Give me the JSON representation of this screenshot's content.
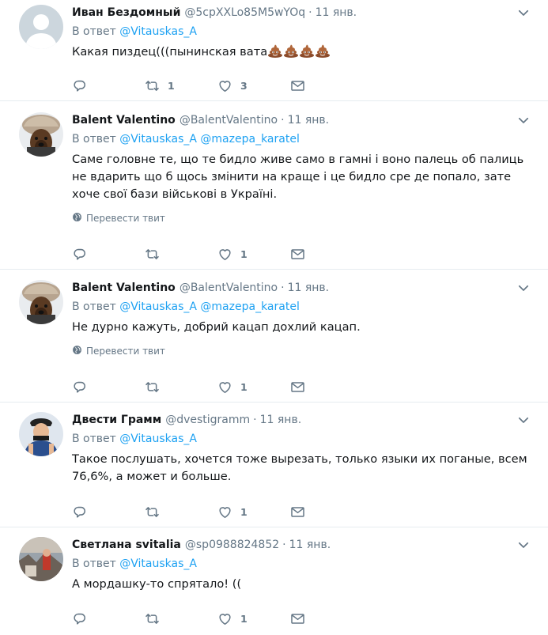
{
  "labels": {
    "reply_prefix": "В ответ",
    "translate": "Перевести твит",
    "time_sep": "·"
  },
  "icons": {
    "reply": "reply-icon",
    "retweet": "retweet-icon",
    "like": "heart-icon",
    "dm": "envelope-icon",
    "caret": "chevron-down-icon",
    "globe": "globe-icon",
    "emoji": "poop-emoji"
  },
  "colors": {
    "accent": "#1da1f2",
    "muted": "#657786",
    "text": "#14171a",
    "divider": "#e6ecf0"
  },
  "tweets": [
    {
      "name": "Иван Бездомный",
      "handle": "@5cpXXLo85M5wYOq",
      "time": "11 янв.",
      "mentions": [
        "@Vitauskas_A"
      ],
      "text": "Какая пиздец(((пынинская вата",
      "emoji_count": 4,
      "show_translate": false,
      "retweets": "1",
      "likes": "3",
      "avatar": "default"
    },
    {
      "name": "Balent Valentino",
      "handle": "@BalentValentino",
      "time": "11 янв.",
      "mentions": [
        "@Vitauskas_A",
        "@mazepa_karatel"
      ],
      "text": "Саме головне те, що те бидло живе само в гамні і воно палець об палиць не вдарить що б щось змінити на краще і це бидло сре де попало, зате хоче свої бази військові в Україні.",
      "emoji_count": 0,
      "show_translate": true,
      "retweets": "",
      "likes": "1",
      "avatar": "dog"
    },
    {
      "name": "Balent Valentino",
      "handle": "@BalentValentino",
      "time": "11 янв.",
      "mentions": [
        "@Vitauskas_A",
        "@mazepa_karatel"
      ],
      "text": "Не дурно кажуть, добрий кацап дохлий кацап.",
      "emoji_count": 0,
      "show_translate": true,
      "retweets": "",
      "likes": "1",
      "avatar": "dog"
    },
    {
      "name": "Двести Грамм",
      "handle": "@dvestigramm",
      "time": "11 янв.",
      "mentions": [
        "@Vitauskas_A"
      ],
      "text": "Такое послушать, хочется тоже вырезать, только языки их поганые, всем 76,6%, а может и больше.",
      "emoji_count": 0,
      "show_translate": false,
      "retweets": "",
      "likes": "1",
      "avatar": "man"
    },
    {
      "name": "Светлана svitalia",
      "handle": "@sp0988824852",
      "time": "11 янв.",
      "mentions": [
        "@Vitauskas_A"
      ],
      "text": "А мордашку-то спрятало! ((",
      "emoji_count": 0,
      "show_translate": false,
      "retweets": "",
      "likes": "1",
      "avatar": "photo"
    }
  ]
}
